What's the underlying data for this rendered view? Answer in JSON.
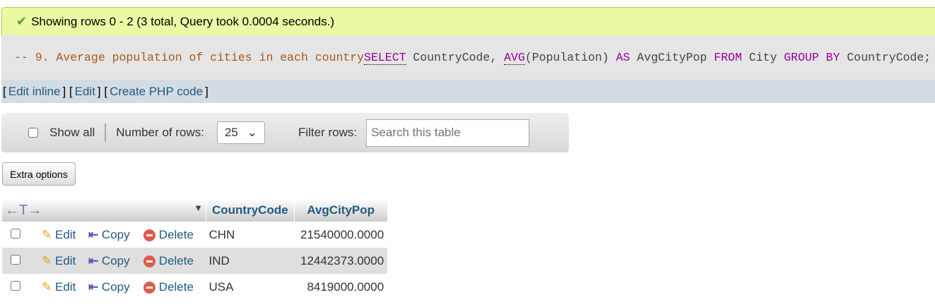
{
  "message": "Showing rows 0 - 2 (3 total, Query took 0.0004 seconds.)",
  "sql": {
    "comment": "-- 9. Average population of cities in each country",
    "kw_select": "SELECT",
    "p1": " CountryCode, ",
    "kw_avg": "AVG",
    "p2": "(Population) ",
    "kw_as": "AS",
    "p3": " AvgCityPop ",
    "kw_from": "FROM",
    "p4": " City ",
    "kw_group": "GROUP BY",
    "p5": " CountryCode;"
  },
  "links": [
    "Edit inline",
    "Edit",
    "Create PHP code"
  ],
  "nav": {
    "show_all": "Show all",
    "rows_label": "Number of rows:",
    "rows_value": "25",
    "filter_label": "Filter rows:",
    "filter_placeholder": "Search this table"
  },
  "extra_options": "Extra options",
  "table": {
    "columns": [
      "CountryCode",
      "AvgCityPop"
    ],
    "actions": {
      "edit": "Edit",
      "copy": "Copy",
      "delete": "Delete"
    },
    "rows": [
      {
        "code": "CHN",
        "avg": "21540000.0000"
      },
      {
        "code": "IND",
        "avg": "12442373.0000"
      },
      {
        "code": "USA",
        "avg": "8419000.0000"
      }
    ]
  }
}
